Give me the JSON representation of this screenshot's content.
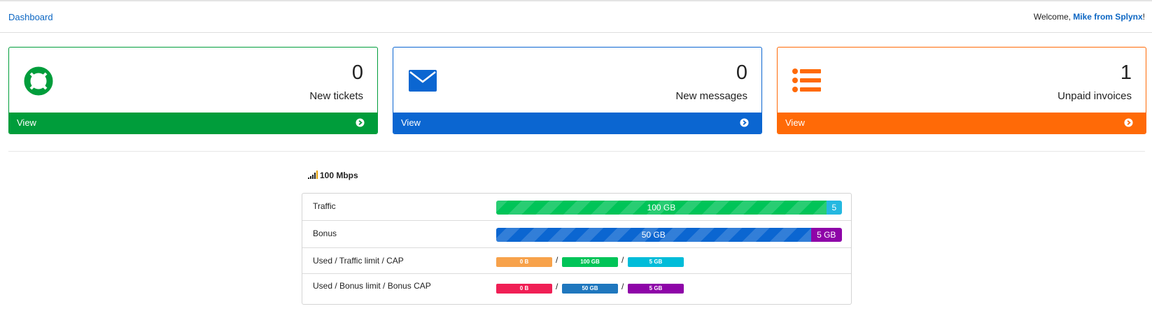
{
  "header": {
    "breadcrumb": "Dashboard",
    "welcome_prefix": "Welcome, ",
    "user_name": "Mike from Splynx",
    "welcome_suffix": "!"
  },
  "cards": [
    {
      "count": "0",
      "label": "New tickets",
      "footer": "View",
      "icon": "lifebuoy-icon",
      "color": "#009d3b"
    },
    {
      "count": "0",
      "label": "New messages",
      "footer": "View",
      "icon": "envelope-icon",
      "color": "#0b66d1"
    },
    {
      "count": "1",
      "label": "Unpaid invoices",
      "footer": "View",
      "icon": "list-icon",
      "color": "#ff6a07"
    }
  ],
  "plan": {
    "speed": "100 Mbps",
    "icon": "signal-icon"
  },
  "usage": {
    "traffic": {
      "label": "Traffic",
      "main_value": "100 GB",
      "main_fraction": 0.955,
      "cap_value": "5",
      "cap_fraction": 0.045,
      "main_color": "#00c458",
      "cap_color": "#24b8e0"
    },
    "bonus": {
      "label": "Bonus",
      "main_value": "50 GB",
      "main_fraction": 0.91,
      "cap_value": "5 GB",
      "cap_fraction": 0.09,
      "main_color": "#0b66d1",
      "cap_color": "#8e05a8"
    },
    "traffic_limits": {
      "label": "Used / Traffic limit / CAP",
      "used": "0 B",
      "limit": "100 GB",
      "cap": "5 GB",
      "separator": "/",
      "colors": [
        "#f7a24b",
        "#00c458",
        "#00bcd9"
      ]
    },
    "bonus_limits": {
      "label": "Used / Bonus limit / Bonus CAP",
      "used": "0 B",
      "limit": "50 GB",
      "cap": "5 GB",
      "separator": "/",
      "colors": [
        "#f01f55",
        "#1f77be",
        "#8e05a8"
      ]
    }
  }
}
